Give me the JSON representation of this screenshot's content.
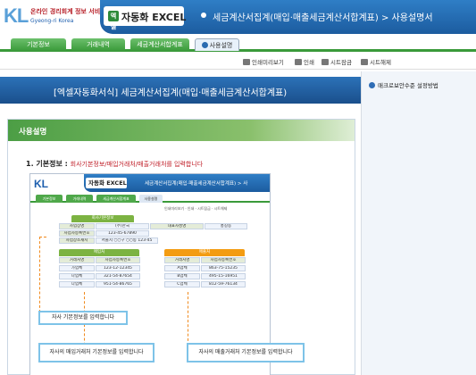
{
  "header": {
    "logo_main": "KL",
    "logo_tagline": "온라인 경리회계 정보 서비스",
    "logo_sub": "Gyeong-ri Korea",
    "product_badge": "엑셀",
    "product_name": "자동화 EXCEL",
    "page_title": "세금계산서집계(매입·매출세금계산서합계표) > 사용설명서"
  },
  "tabs": [
    {
      "label": "기본정보"
    },
    {
      "label": "거래내역"
    },
    {
      "label": "세금계산서합계표"
    },
    {
      "label": "사용설명"
    }
  ],
  "toolbar": {
    "preview": "인쇄미리보기",
    "print": "인쇄",
    "sheet_protect": "시트잠금",
    "sheet_unprotect": "시트해제"
  },
  "banner": {
    "title": "[엑셀자동화서식] 세금계산서집계(매입·매출세금계산서합계표)"
  },
  "side": {
    "macro_link": "매크로보안수준 설정방법"
  },
  "section": {
    "title": "사용설명",
    "step_label": "1. 기본정보 :",
    "step_desc": "회사기본정보/매입거래처/매출거래처를 입력합니다"
  },
  "inner": {
    "logo": "KL",
    "product": "자동화 EXCEL",
    "header_title": "세금계산서집계(매입·매출세금계산서합계표) > 사",
    "tabs": [
      "기본정보",
      "거래내역",
      "세금계산서합계표",
      "사용설명"
    ],
    "toolbar": "인쇄미리보기 · 인쇄 · 시트잠금 · 시트해제",
    "company_header": "회사기본정보",
    "company_rows": [
      [
        "사업장명",
        "(주)한국",
        "대표자성명",
        "홍길동"
      ],
      [
        "사업자등록번호",
        "123-45-67890",
        "",
        ""
      ],
      [
        "사업장소재지",
        "서울시 ○○구 ○○동 123-45",
        "",
        ""
      ]
    ],
    "purchase_header": "매입처",
    "sales_header": "매출처",
    "col_headers": [
      "거래처명",
      "사업자등록번호"
    ],
    "purchase_rows": [
      [
        "가업체",
        "123-12-12345"
      ],
      [
        "나업체",
        "321-54-87654"
      ],
      [
        "다업체",
        "951-54-86765"
      ]
    ],
    "sales_rows": [
      [
        "A업체",
        "863-75-15235"
      ],
      [
        "B업체",
        "495-15-16951"
      ],
      [
        "C업체",
        "812-59-76134"
      ]
    ]
  },
  "callouts": {
    "company": "자사 기본정보를 입력합니다",
    "purchase": "자사의 매입거래처 기본정보를 입력합니다",
    "sales": "자사의 매출거래처 기본정보를 입력합니다"
  },
  "colors": {
    "brand_blue": "#1c5c9f",
    "tab_green": "#3a9a3a",
    "step_red": "#c0202a",
    "callout_border": "#7ec3e8",
    "dash_orange": "#f08a1e"
  }
}
